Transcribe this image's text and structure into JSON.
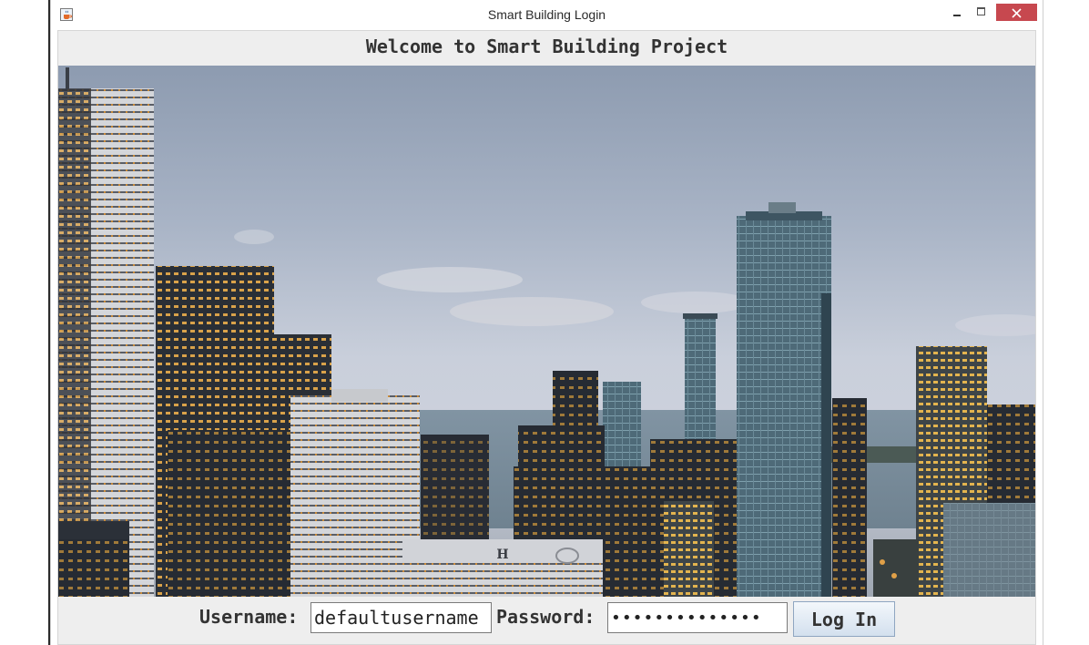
{
  "window": {
    "title": "Smart Building Login",
    "icon": "java-cup-icon"
  },
  "header": {
    "title": "Welcome to Smart Building Project"
  },
  "hero": {
    "description_icon": "city-skyline-image"
  },
  "form": {
    "username_label": "Username:",
    "username_value": "defaultusername",
    "password_label": "Password:",
    "password_value": "••••••••••••••",
    "login_label": "Log In"
  },
  "colors": {
    "close_button": "#c7484f",
    "content_bg": "#eeeeee",
    "button_border": "#8fa6c1"
  }
}
